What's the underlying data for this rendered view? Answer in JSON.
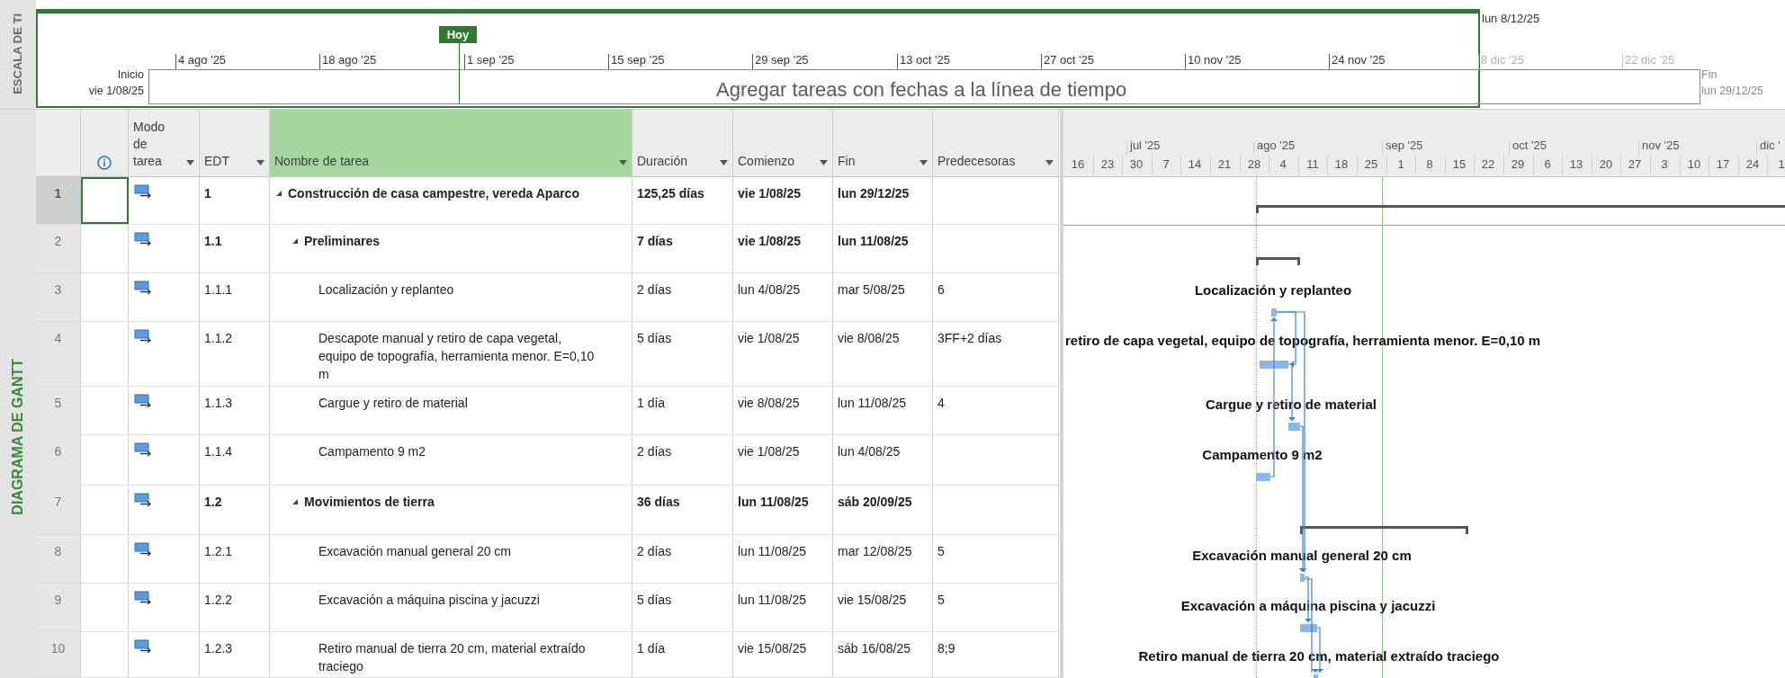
{
  "timeline": {
    "side_label": "ESCALA DE TI",
    "marker_date": "lun 8/12/25",
    "today_label": "Hoy",
    "start_label": "Inicio",
    "start_date": "vie 1/08/25",
    "finish_label": "Fin",
    "finish_date": "lun 29/12/25",
    "placeholder": "Agregar tareas con fechas a la línea de tiempo",
    "ticks": [
      {
        "label": "4 ago '25",
        "dimmed": false
      },
      {
        "label": "18 ago '25",
        "dimmed": false
      },
      {
        "label": "1 sep '25",
        "dimmed": false
      },
      {
        "label": "15 sep '25",
        "dimmed": false
      },
      {
        "label": "29 sep '25",
        "dimmed": false
      },
      {
        "label": "13 oct '25",
        "dimmed": false
      },
      {
        "label": "27 oct '25",
        "dimmed": false
      },
      {
        "label": "10 nov '25",
        "dimmed": false
      },
      {
        "label": "24 nov '25",
        "dimmed": false
      },
      {
        "label": "8 dic '25",
        "dimmed": true
      },
      {
        "label": "22 dic '25",
        "dimmed": true
      }
    ]
  },
  "view_label": "DIAGRAMA DE GANTT",
  "table": {
    "columns": [
      {
        "kind": "info",
        "selected": false
      },
      {
        "kind": "text",
        "label": "Modo de tarea",
        "selected": false
      },
      {
        "kind": "text",
        "label": "EDT",
        "selected": false
      },
      {
        "kind": "text",
        "label": "Nombre de tarea",
        "selected": true
      },
      {
        "kind": "text",
        "label": "Duración",
        "selected": false
      },
      {
        "kind": "text",
        "label": "Comienzo",
        "selected": false
      },
      {
        "kind": "text",
        "label": "Fin",
        "selected": false
      },
      {
        "kind": "text",
        "label": "Predecesoras",
        "selected": false
      }
    ],
    "rows": [
      {
        "number": "1",
        "wbs": "1",
        "name": "Construcción de casa campestre, vereda Aparco",
        "duration": "125,25 días",
        "start": "vie 1/08/25",
        "finish": "lun 29/12/25",
        "summary": true,
        "expanded": true,
        "selected": true,
        "children": [
          {
            "number": "2",
            "wbs": "1.1",
            "name": "Preliminares",
            "duration": "7 días",
            "start": "vie 1/08/25",
            "finish": "lun 11/08/25",
            "summary": true,
            "expanded": true,
            "selected": false,
            "children": [
              {
                "number": "3",
                "wbs": "1.1.1",
                "name": "Localización y replanteo",
                "duration": "2 días",
                "start": "lun 4/08/25",
                "finish": "mar 5/08/25",
                "predecessors": "6",
                "summary": false,
                "selected": false
              },
              {
                "number": "4",
                "wbs": "1.1.2",
                "name": "Descapote manual y retiro de capa vegetal, equipo de topografía, herramienta menor. E=0,10 m",
                "duration": "5 días",
                "start": "vie 1/08/25",
                "finish": "vie 8/08/25",
                "predecessors": "3FF+2 días",
                "summary": false,
                "selected": false
              },
              {
                "number": "5",
                "wbs": "1.1.3",
                "name": "Cargue y retiro de material",
                "duration": "1 día",
                "start": "vie 8/08/25",
                "finish": "lun 11/08/25",
                "predecessors": "4",
                "summary": false,
                "selected": false
              },
              {
                "number": "6",
                "wbs": "1.1.4",
                "name": "Campamento 9 m2",
                "duration": "2 días",
                "start": "vie 1/08/25",
                "finish": "lun 4/08/25",
                "summary": false,
                "selected": false
              }
            ]
          },
          {
            "number": "7",
            "wbs": "1.2",
            "name": "Movimientos de tierra",
            "duration": "36 días",
            "start": "lun 11/08/25",
            "finish": "sáb 20/09/25",
            "summary": true,
            "expanded": true,
            "selected": false,
            "children": [
              {
                "number": "8",
                "wbs": "1.2.1",
                "name": "Excavación manual general 20 cm",
                "duration": "2 días",
                "start": "lun 11/08/25",
                "finish": "mar 12/08/25",
                "predecessors": "5",
                "summary": false,
                "selected": false
              },
              {
                "number": "9",
                "wbs": "1.2.2",
                "name": "Excavación a máquina piscina y jacuzzi",
                "duration": "5 días",
                "start": "lun 11/08/25",
                "finish": "vie 15/08/25",
                "predecessors": "5",
                "summary": false,
                "selected": false
              },
              {
                "number": "10",
                "wbs": "1.2.3",
                "name": "Retiro manual de tierra 20 cm, material extraído traciego",
                "duration": "1 día",
                "start": "vie 15/08/25",
                "finish": "sáb 16/08/25",
                "predecessors": "8;9",
                "summary": false,
                "selected": false
              }
            ]
          }
        ]
      }
    ]
  },
  "gantt": {
    "months": [
      "jul '25",
      "ago '25",
      "sep '25",
      "oct '25",
      "nov '25",
      "dic '"
    ],
    "weeks": [
      "16",
      "23",
      "30",
      "7",
      "14",
      "21",
      "28",
      "4",
      "11",
      "18",
      "25",
      "1",
      "8",
      "15",
      "22",
      "29",
      "6",
      "13",
      "20",
      "27",
      "3",
      "10",
      "17",
      "24",
      "1"
    ],
    "bars": [
      {
        "kind": "summary"
      },
      {
        "kind": "summary"
      },
      {
        "kind": "task",
        "label": "Localización y replanteo"
      },
      {
        "kind": "task",
        "label": "retiro de capa vegetal, equipo de topografía, herramienta menor. E=0,10 m"
      },
      {
        "kind": "task",
        "label": "Cargue y retiro de material"
      },
      {
        "kind": "task",
        "label": "Campamento 9 m2"
      },
      {
        "kind": "summary"
      },
      {
        "kind": "task",
        "label": "Excavación manual general 20 cm"
      },
      {
        "kind": "task",
        "label": "Excavación a máquina piscina y jacuzzi"
      },
      {
        "kind": "task",
        "label": "Retiro manual de tierra 20 cm, material extraído traciego"
      }
    ]
  }
}
